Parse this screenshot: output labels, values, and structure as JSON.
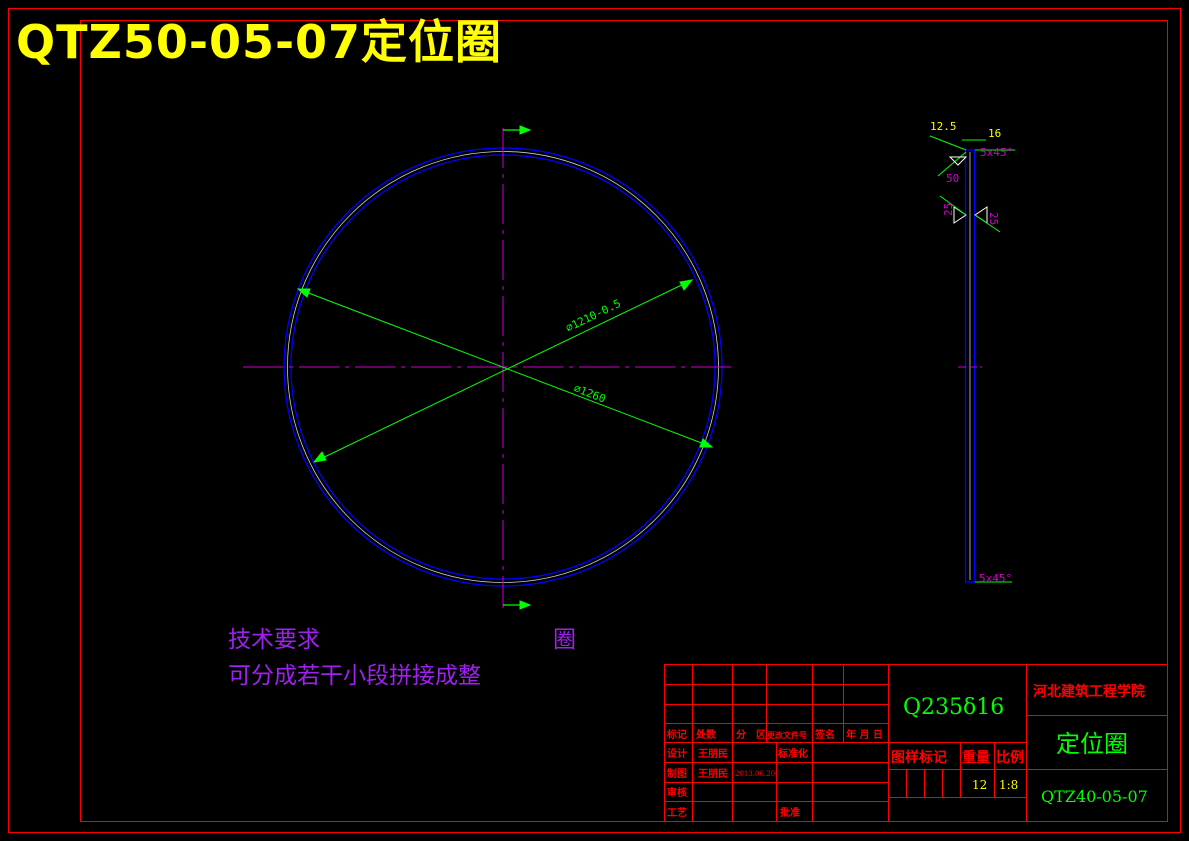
{
  "title": "QTZ50-05-07定位圈",
  "colors": {
    "frame": "#ff0000",
    "circle": "#0000ff",
    "dimension": "#00ff00",
    "centerline": "#cc00cc",
    "dim_text": "#00ff00",
    "note_text": "#a020f0",
    "title_text": "#ffff00",
    "table_red": "#ff0000"
  },
  "front_view": {
    "dim_inner": "⌀1210-0.5",
    "dim_outer": "⌀1260"
  },
  "side_view": {
    "dim_width": "12.5",
    "dim_thickness": "16",
    "dim_chamfer_top": "5x45°",
    "dim_weld": "50",
    "dim_left": "25",
    "dim_right": "25",
    "dim_chamfer_bottom": "5x45°"
  },
  "tech_notes": {
    "heading": "技术要求",
    "heading_suffix": "圈",
    "line1": "可分成若干小段拼接成整"
  },
  "title_block": {
    "material": "Q235δ16",
    "school": "河北建筑工程学院",
    "part_name": "定位圈",
    "drawing_no": "QTZ40-05-07",
    "hdr_mark": "标记",
    "hdr_count": "处数",
    "hdr_zone": "分　区",
    "hdr_doc": "更改文件号",
    "hdr_sign": "签名",
    "hdr_date": "年 月 日",
    "row_design": "设计",
    "row_draw": "制图",
    "row_check": "审核",
    "row_craft": "工艺",
    "designer": "王朋民",
    "drafter": "王朋民",
    "draw_date": "2013.06.20",
    "std": "标准化",
    "approve": "批准",
    "stage_mark": "图样标记",
    "weight": "重量",
    "scale_lbl": "比例",
    "weight_val": "12",
    "scale_val": "1:8"
  }
}
